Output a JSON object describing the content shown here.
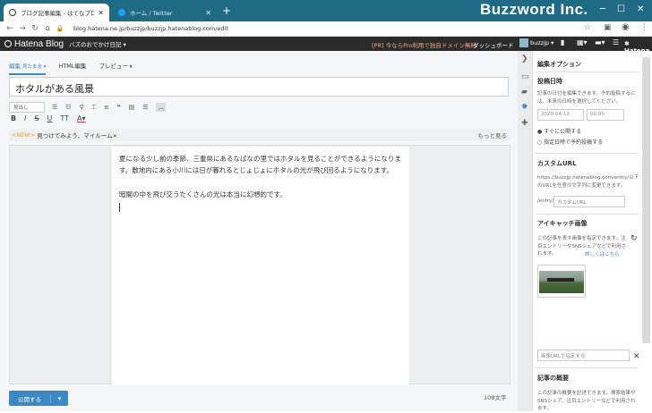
{
  "browser": {
    "tabs": [
      {
        "title": "ブログ記事編集 - はてなブログ",
        "icon": "hatena-icon",
        "color": "#333333"
      },
      {
        "title": "ホーム / Twitter",
        "icon": "twitter-icon",
        "color": "#1da1f2"
      }
    ],
    "new_tab": "+",
    "brand_overlay": "Buzzword Inc.",
    "url": "blog.hatena.ne.jp/buzzjp/buzzjp.hatenablog.com/edit"
  },
  "header": {
    "logo": "Hatena Blog",
    "blog_name": "バズのおでかけ日記 ▾",
    "promo": "[PR] 今ならPro利用で独自ドメイン無料",
    "dashboard": "ダッシュボード",
    "user": "buzzjp ▾",
    "hatena": "✱ Hatena"
  },
  "editor": {
    "tabs": [
      {
        "label": "編集",
        "sub": "見たまま ▾",
        "active": true
      },
      {
        "label": "HTML編集",
        "sub": "",
        "active": false
      },
      {
        "label": "プレビュー",
        "sub": " ▾",
        "active": false
      }
    ],
    "title": "ホタルがある風景",
    "heading_select": "見出し",
    "news_tag": "<NEW>",
    "news_text": "見つけてみよう、マイルーム×",
    "news_more": "もっと見る",
    "paragraphs": [
      "夏になる少し前の季節、三重県にあるなばなの里ではホタルを見ることができるようになります。敷地内にある小川には日が暮れるとじょじょにホタルの光が飛び回るようになります。",
      "暗闇の中を飛び交うたくさんの光は本当に幻想的です。"
    ],
    "publish_label": "公開する",
    "publish_caret": "▾",
    "word_count": "108文字"
  },
  "panel": {
    "title": "編集オプション",
    "date_heading": "投稿日時",
    "date_desc": "記事の日付を編集できます。予約投稿するには、未来の日時を選択してください。",
    "date_value": "2020-04-12",
    "time_value": "00:00",
    "radio_now": "すぐに公開する",
    "radio_schedule": "指定日時で予約投稿する",
    "url_heading": "カスタムURL",
    "url_desc": "https://buzzjp.hatenablog.com/entry/以下のURLを任意の文字列に変更できます。",
    "url_prefix": "/entry/",
    "url_placeholder": "カスタムURL",
    "eye_heading": "アイキャッチ画像",
    "eye_desc": "この記事を表す画像を指定できます。注目エントリーやSNSシェアなどで利用されます。",
    "eye_link": "詳しくはこちら",
    "img_url_placeholder": "画像URLで指定する",
    "summary_heading": "記事の概要",
    "summary_desc": "この記事の概要を記述できます。検索結果やSNSシェア、注目エントリーなどで利用されます。"
  }
}
